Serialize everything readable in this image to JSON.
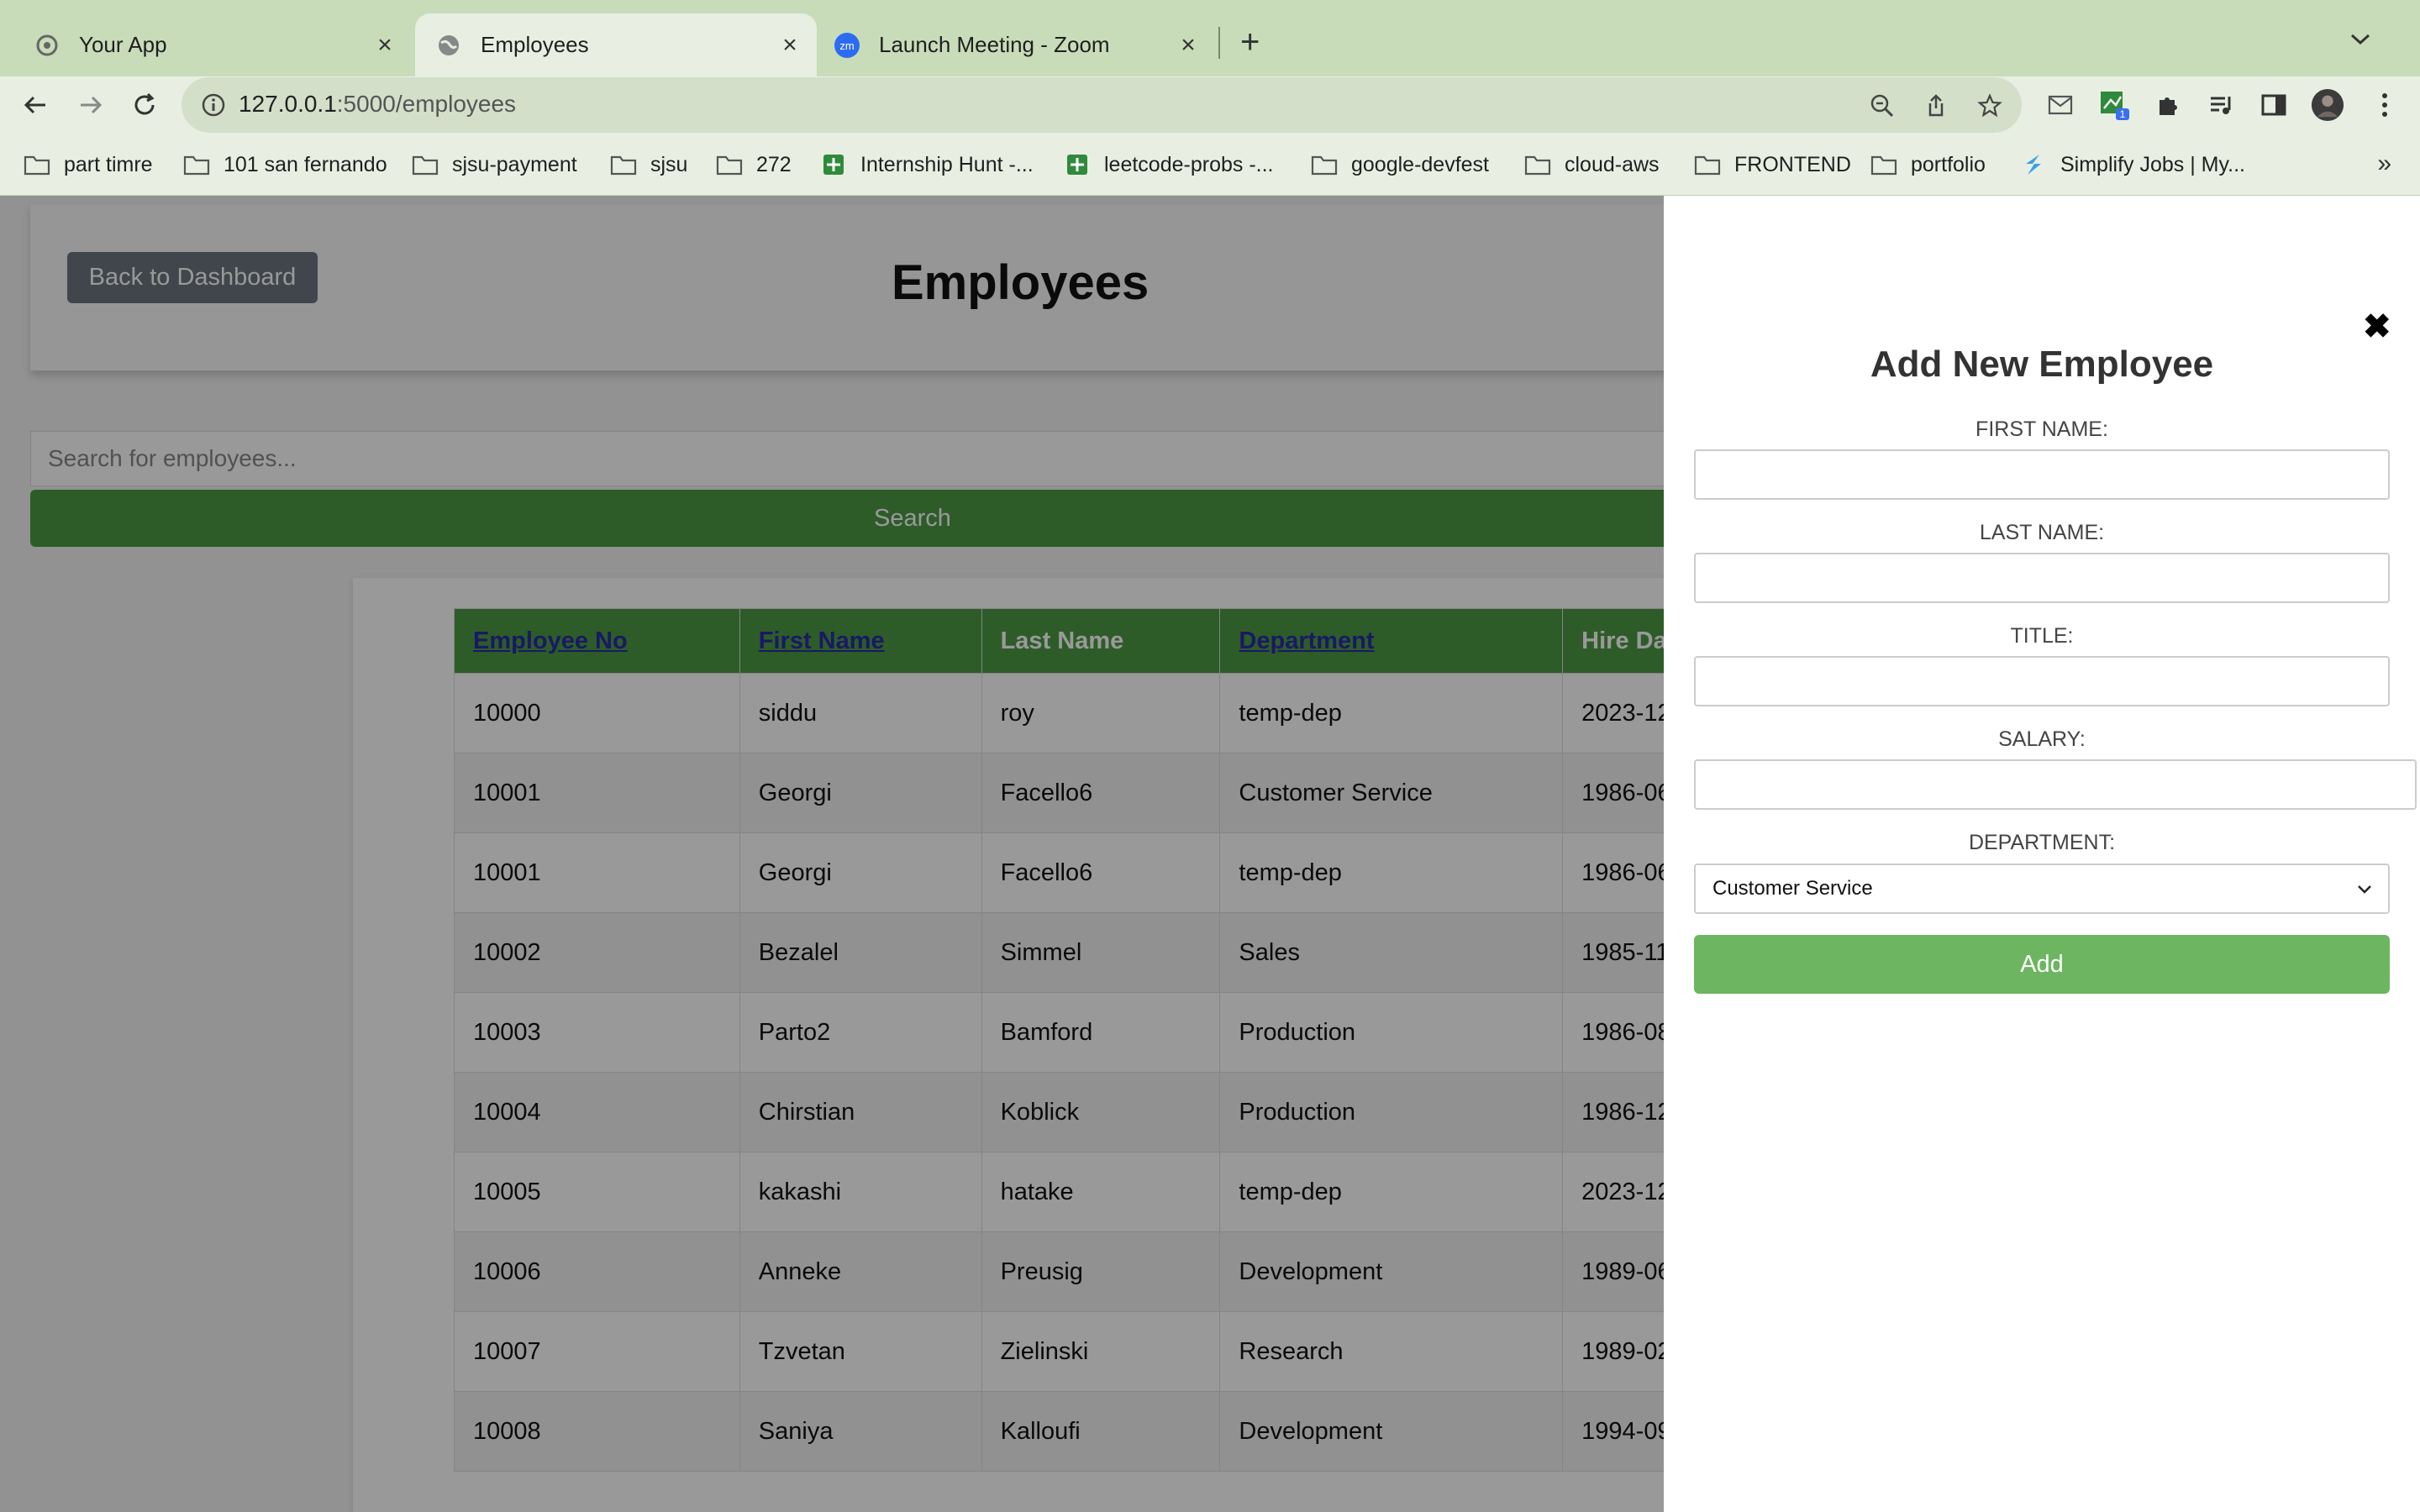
{
  "browser": {
    "tabs": [
      {
        "title": "Your App",
        "favicon": "gear-icon"
      },
      {
        "title": "Employees",
        "favicon": "globe-icon",
        "active": true
      },
      {
        "title": "Launch Meeting - Zoom",
        "favicon": "zoom-icon"
      }
    ],
    "zoom_badge": "zm",
    "url_host": "127.0.0.1",
    "url_path": ":5000/employees",
    "extension_badge": "1",
    "bookmarks": [
      {
        "label": "part timre",
        "icon": "folder-icon"
      },
      {
        "label": "101 san fernando",
        "icon": "folder-icon"
      },
      {
        "label": "sjsu-payment",
        "icon": "folder-icon"
      },
      {
        "label": "sjsu",
        "icon": "folder-icon"
      },
      {
        "label": "272",
        "icon": "folder-icon"
      },
      {
        "label": "Internship Hunt -...",
        "icon": "sheets-icon"
      },
      {
        "label": "leetcode-probs -...",
        "icon": "sheets-icon"
      },
      {
        "label": "google-devfest",
        "icon": "folder-icon"
      },
      {
        "label": "cloud-aws",
        "icon": "folder-icon"
      },
      {
        "label": "FRONTEND",
        "icon": "folder-icon"
      },
      {
        "label": "portfolio",
        "icon": "folder-icon"
      },
      {
        "label": "Simplify Jobs | My...",
        "icon": "simplify-icon"
      }
    ],
    "bookmarks_more": "»"
  },
  "page": {
    "back_label": "Back to Dashboard",
    "title": "Employees",
    "search_placeholder": "Search for employees...",
    "search_label": "Search",
    "table": {
      "headers": [
        "Employee No",
        "First Name",
        "Last Name",
        "Department",
        "Hire Da"
      ],
      "sortable": [
        true,
        true,
        false,
        true,
        false
      ],
      "rows": [
        [
          "10000",
          "siddu",
          "roy",
          "temp-dep",
          "2023-12"
        ],
        [
          "10001",
          "Georgi",
          "Facello6",
          "Customer Service",
          "1986-06"
        ],
        [
          "10001",
          "Georgi",
          "Facello6",
          "temp-dep",
          "1986-06"
        ],
        [
          "10002",
          "Bezalel",
          "Simmel",
          "Sales",
          "1985-11"
        ],
        [
          "10003",
          "Parto2",
          "Bamford",
          "Production",
          "1986-08"
        ],
        [
          "10004",
          "Chirstian",
          "Koblick",
          "Production",
          "1986-12"
        ],
        [
          "10005",
          "kakashi",
          "hatake",
          "temp-dep",
          "2023-12"
        ],
        [
          "10006",
          "Anneke",
          "Preusig",
          "Development",
          "1989-06"
        ],
        [
          "10007",
          "Tzvetan",
          "Zielinski",
          "Research",
          "1989-02"
        ],
        [
          "10008",
          "Saniya",
          "Kalloufi",
          "Development",
          "1994-09"
        ]
      ]
    }
  },
  "panel": {
    "close_glyph": "✖",
    "title": "Add New Employee",
    "fields": [
      {
        "label": "FIRST NAME:",
        "value": ""
      },
      {
        "label": "LAST NAME:",
        "value": ""
      },
      {
        "label": "TITLE:",
        "value": ""
      },
      {
        "label": "SALARY:",
        "value": ""
      }
    ],
    "department_label": "DEPARTMENT:",
    "department_value": "Customer Service",
    "add_label": "Add"
  },
  "colors": {
    "accent_green": "#4c9a43",
    "add_green": "#6db560",
    "tabstrip": "#c8dcb9",
    "link_purple": "#2a2aa8"
  }
}
